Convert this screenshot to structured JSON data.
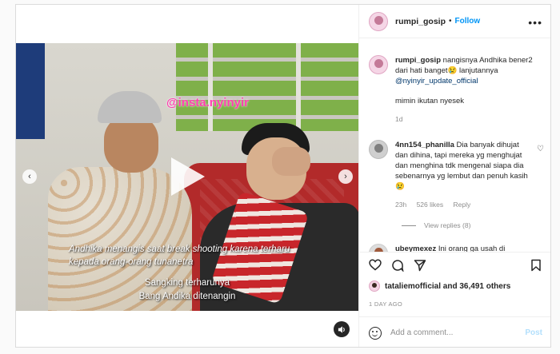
{
  "post": {
    "author": "rumpi_gosip",
    "follow_label": "Follow",
    "separator": "•",
    "more_icon": "more-icon"
  },
  "video": {
    "watermark": "@insta.nyinyir",
    "caption_top_line1": "Andhika menangis saat break shooting karena terharu",
    "caption_top_line2": "kepada orang-orang tunanetra",
    "caption_bottom_line1": "Sangking terharunya",
    "caption_bottom_line2": "Bang Andika ditenangin",
    "prev_icon": "‹",
    "next_icon": "›"
  },
  "caption": {
    "user": "rumpi_gosip",
    "text_before": " nangisnya Andhika bener2 dari hati banget😢 lanjutannya ",
    "mention": "@nyinyir_update_official",
    "extra": "mimin ikutan nyesek",
    "time": "1d"
  },
  "comments": [
    {
      "user": "4nn154_phanilla",
      "text": " Dia banyak dihujat dan dihina, tapi mereka yg menghujat dan menghina tdk mengenal siapa dia sebenarnya yg lembut dan penuh kasih 😢",
      "time": "23h",
      "likes": "526 likes",
      "reply": "Reply",
      "view_replies": "View replies (8)"
    },
    {
      "user": "ubeymexez",
      "text": " Ini orang ga usah di"
    }
  ],
  "actions": {
    "likes_user": "tataliemofficial",
    "likes_rest": " and 36,491 others",
    "time_ago": "1 DAY AGO"
  },
  "add_comment": {
    "placeholder": "Add a comment...",
    "post_label": "Post"
  }
}
